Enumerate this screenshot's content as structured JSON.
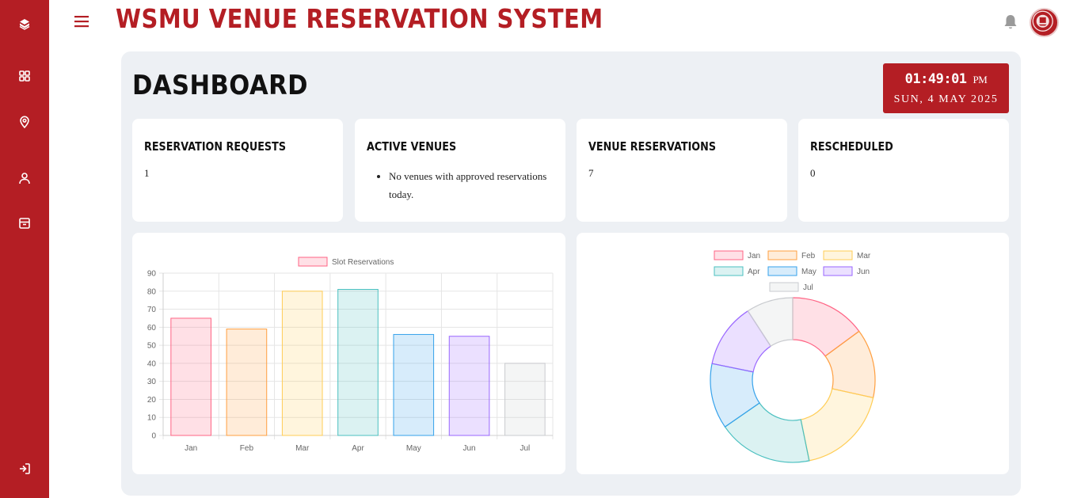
{
  "app": {
    "title": "WSMU VENUE RESERVATION SYSTEM"
  },
  "sidebar": {
    "items": [
      {
        "icon": "cube-icon",
        "name": "sidebar-item-home"
      },
      {
        "icon": "grid-icon",
        "name": "sidebar-item-dashboard"
      },
      {
        "icon": "location-pin-icon",
        "name": "sidebar-item-venues"
      },
      {
        "icon": "user-icon",
        "name": "sidebar-item-profile"
      },
      {
        "icon": "archive-icon",
        "name": "sidebar-item-records"
      }
    ],
    "logout_icon": "logout-icon"
  },
  "header": {
    "menu_icon": "hamburger-icon",
    "notification_icon": "bell-icon"
  },
  "page": {
    "title": "DASHBOARD"
  },
  "clock": {
    "time": "01:49:01",
    "ampm": "PM",
    "date": "SUN, 4 MAY 2025"
  },
  "cards": [
    {
      "title": "RESERVATION REQUESTS",
      "value": "1"
    },
    {
      "title": "ACTIVE VENUES",
      "list": [
        "No venues with approved reservations today."
      ]
    },
    {
      "title": "VENUE RESERVATIONS",
      "value": "7"
    },
    {
      "title": "RESCHEDULED",
      "value": "0"
    }
  ],
  "colors": {
    "brand": "#b41e24",
    "panel": "#edf0f4"
  },
  "chart_data": [
    {
      "type": "bar",
      "categories": [
        "Jan",
        "Feb",
        "Mar",
        "Apr",
        "May",
        "Jun",
        "Jul"
      ],
      "series": [
        {
          "name": "Slot Reservations",
          "values": [
            65,
            59,
            80,
            81,
            56,
            55,
            40
          ]
        }
      ],
      "ylim": [
        0,
        90
      ],
      "yticks": [
        0,
        10,
        20,
        30,
        40,
        50,
        60,
        70,
        80,
        90
      ],
      "legend": "top",
      "grid": true,
      "bar_colors": [
        "#ff6384",
        "#ff9f40",
        "#ffcd56",
        "#4bc0c0",
        "#36a2eb",
        "#9966ff",
        "#c9cbcf"
      ]
    },
    {
      "type": "pie",
      "variant": "doughnut",
      "labels": [
        "Jan",
        "Feb",
        "Mar",
        "Apr",
        "May",
        "Jun",
        "Jul"
      ],
      "values": [
        65,
        59,
        80,
        81,
        56,
        55,
        40
      ],
      "legend": "top",
      "colors": [
        "#ff6384",
        "#ff9f40",
        "#ffcd56",
        "#4bc0c0",
        "#36a2eb",
        "#9966ff",
        "#c9cbcf"
      ]
    }
  ]
}
